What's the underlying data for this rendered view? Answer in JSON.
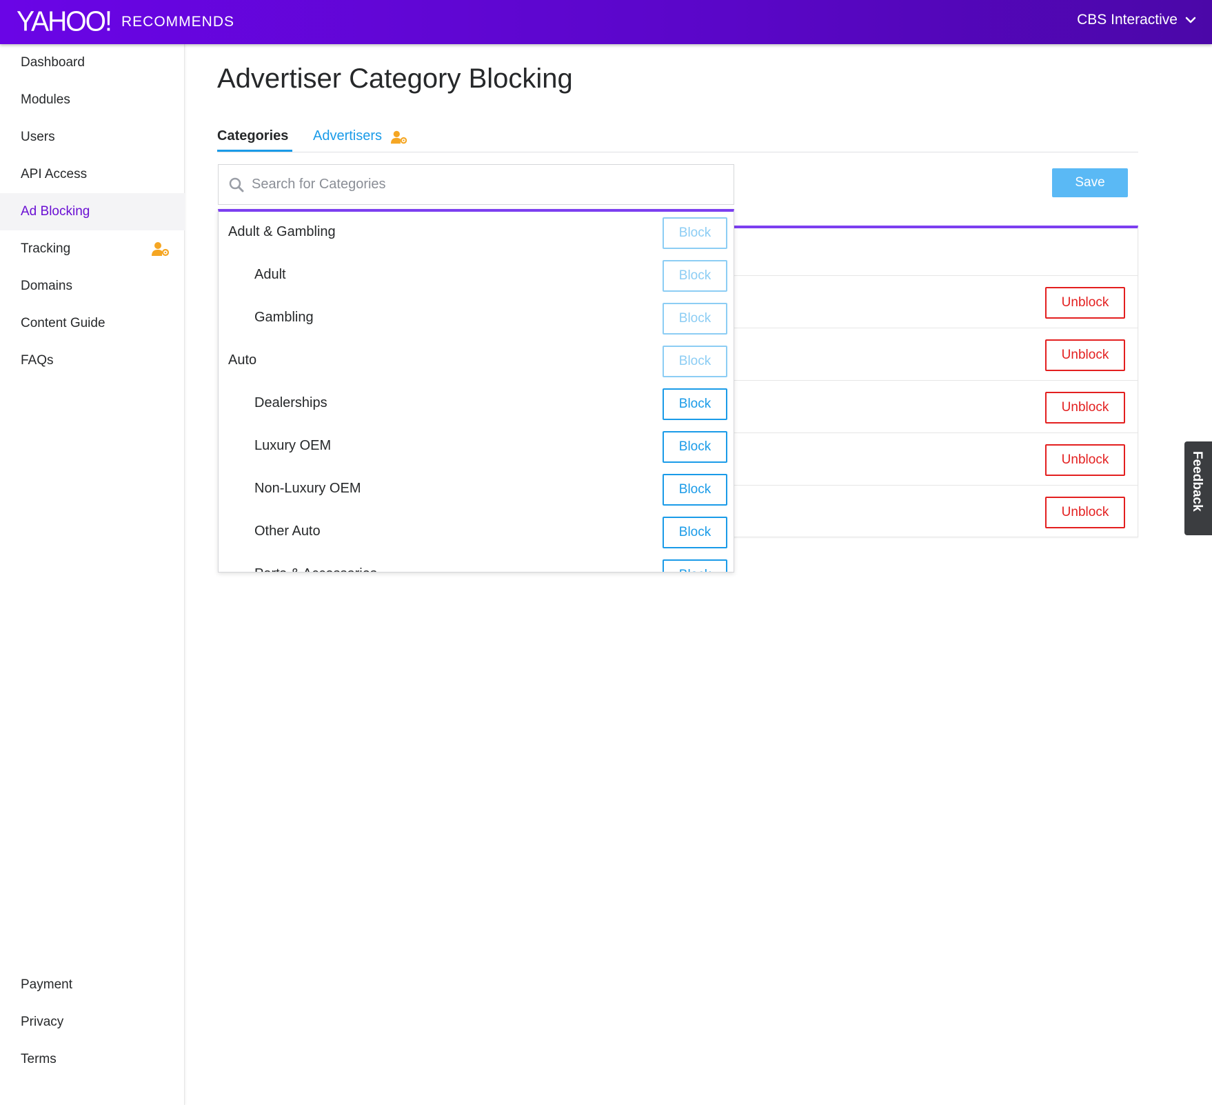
{
  "header": {
    "logo": "YAHOO!",
    "product": "RECOMMENDS",
    "account": "CBS Interactive",
    "account_icon": "chevron-down-icon"
  },
  "sidebar": {
    "items": [
      {
        "label": "Dashboard"
      },
      {
        "label": "Modules"
      },
      {
        "label": "Users"
      },
      {
        "label": "API Access"
      },
      {
        "label": "Ad Blocking",
        "active": true
      },
      {
        "label": "Tracking",
        "icon": "user-gear-icon"
      },
      {
        "label": "Domains"
      },
      {
        "label": "Content Guide"
      },
      {
        "label": "FAQs"
      }
    ],
    "footer_items": [
      {
        "label": "Payment"
      },
      {
        "label": "Privacy"
      },
      {
        "label": "Terms"
      }
    ]
  },
  "main": {
    "title": "Advertiser Category Blocking",
    "tabs": [
      {
        "label": "Categories",
        "active": true
      },
      {
        "label": "Advertisers",
        "icon": "user-gear-icon"
      }
    ],
    "search": {
      "placeholder": "Search for Categories",
      "value": ""
    },
    "save_label": "Save",
    "dropdown": [
      {
        "label": "Adult & Gambling",
        "level": 0,
        "button": "Block",
        "enabled": false
      },
      {
        "label": "Adult",
        "level": 1,
        "button": "Block",
        "enabled": false
      },
      {
        "label": "Gambling",
        "level": 1,
        "button": "Block",
        "enabled": false
      },
      {
        "label": "Auto",
        "level": 0,
        "button": "Block",
        "enabled": false
      },
      {
        "label": "Dealerships",
        "level": 1,
        "button": "Block",
        "enabled": true
      },
      {
        "label": "Luxury OEM",
        "level": 1,
        "button": "Block",
        "enabled": true
      },
      {
        "label": "Non-Luxury OEM",
        "level": 1,
        "button": "Block",
        "enabled": true
      },
      {
        "label": "Other Auto",
        "level": 1,
        "button": "Block",
        "enabled": true
      },
      {
        "label": "Parts & Accessories",
        "level": 1,
        "button": "Block",
        "enabled": true
      }
    ],
    "blocked": [
      {
        "button": "Unblock"
      },
      {
        "button": "Unblock"
      },
      {
        "button": "Unblock"
      },
      {
        "button": "Unblock"
      },
      {
        "button": "Unblock"
      }
    ]
  },
  "feedback_label": "Feedback",
  "colors": {
    "header_start": "#6a05e6",
    "header_end": "#4b07a8",
    "accent_purple": "#7c3ff0",
    "link_blue": "#1a9be8",
    "save_blue": "#5ab9f5",
    "unblock_red": "#e31f1f",
    "tracking_icon": "#f5a623"
  }
}
